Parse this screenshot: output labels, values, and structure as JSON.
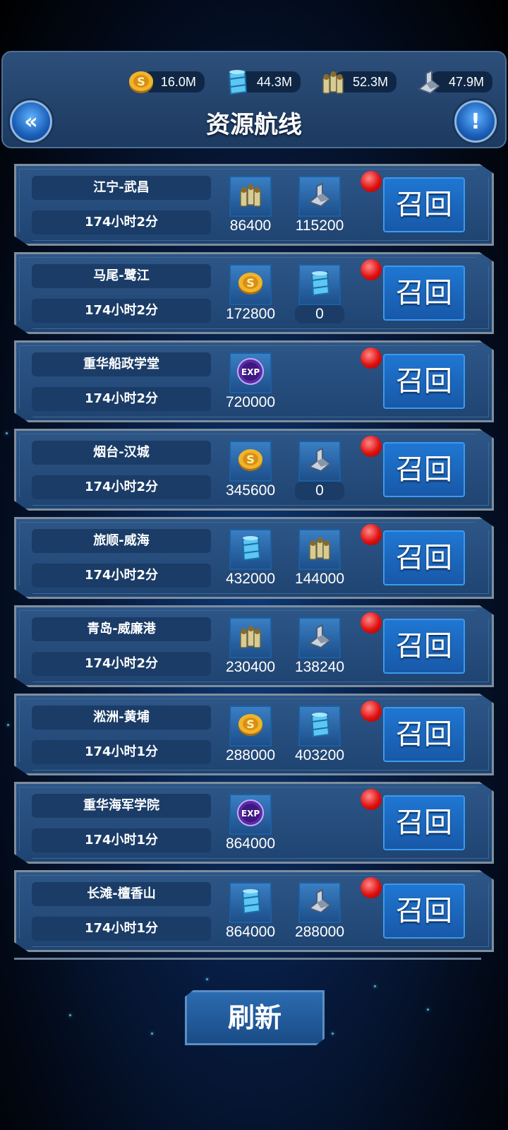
{
  "header": {
    "title": "资源航线",
    "resources": [
      {
        "icon": "gold-coin-icon",
        "value": "16.0M"
      },
      {
        "icon": "oil-barrel-icon",
        "value": "44.3M"
      },
      {
        "icon": "ammo-icon",
        "value": "52.3M"
      },
      {
        "icon": "steel-icon",
        "value": "47.9M"
      }
    ]
  },
  "routes": [
    {
      "name": "江宁-武昌",
      "time": "174小时2分",
      "items": [
        {
          "icon": "ammo-icon",
          "value": "86400"
        },
        {
          "icon": "steel-icon",
          "value": "115200"
        }
      ],
      "action": "召回"
    },
    {
      "name": "马尾-鹭江",
      "time": "174小时2分",
      "items": [
        {
          "icon": "gold-coin-icon",
          "value": "172800"
        },
        {
          "icon": "oil-barrel-icon",
          "value": "0"
        }
      ],
      "action": "召回"
    },
    {
      "name": "重华船政学堂",
      "time": "174小时2分",
      "items": [
        {
          "icon": "exp-icon",
          "value": "720000"
        }
      ],
      "action": "召回"
    },
    {
      "name": "烟台-汉城",
      "time": "174小时2分",
      "items": [
        {
          "icon": "gold-coin-icon",
          "value": "345600"
        },
        {
          "icon": "steel-icon",
          "value": "0"
        }
      ],
      "action": "召回"
    },
    {
      "name": "旅顺-威海",
      "time": "174小时2分",
      "items": [
        {
          "icon": "oil-barrel-icon",
          "value": "432000"
        },
        {
          "icon": "ammo-icon",
          "value": "144000"
        }
      ],
      "action": "召回"
    },
    {
      "name": "青岛-威廉港",
      "time": "174小时2分",
      "items": [
        {
          "icon": "ammo-icon",
          "value": "230400"
        },
        {
          "icon": "steel-icon",
          "value": "138240"
        }
      ],
      "action": "召回"
    },
    {
      "name": "淞洲-黄埔",
      "time": "174小时1分",
      "items": [
        {
          "icon": "gold-coin-icon",
          "value": "288000"
        },
        {
          "icon": "oil-barrel-icon",
          "value": "403200"
        }
      ],
      "action": "召回"
    },
    {
      "name": "重华海军学院",
      "time": "174小时1分",
      "items": [
        {
          "icon": "exp-icon",
          "value": "864000"
        }
      ],
      "action": "召回"
    },
    {
      "name": "长滩-檀香山",
      "time": "174小时1分",
      "items": [
        {
          "icon": "oil-barrel-icon",
          "value": "864000"
        },
        {
          "icon": "steel-icon",
          "value": "288000"
        }
      ],
      "action": "召回"
    }
  ],
  "footer": {
    "refresh_label": "刷新"
  },
  "colors": {
    "panel": "#24497a",
    "recall": "#1f6cc4",
    "badge": "#e01010"
  }
}
